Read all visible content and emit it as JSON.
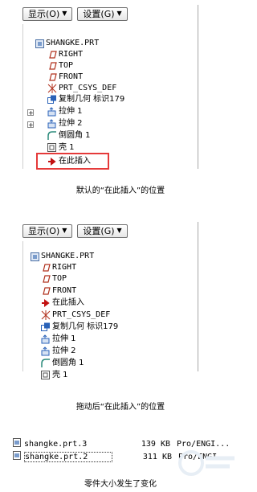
{
  "panel1": {
    "toolbar": {
      "show_label": "显示(O)",
      "settings_label": "设置(G)"
    },
    "items": [
      {
        "label": "SHANGKE.PRT",
        "icon": "part-icon"
      },
      {
        "label": "RIGHT",
        "icon": "datum-plane-icon"
      },
      {
        "label": "TOP",
        "icon": "datum-plane-icon"
      },
      {
        "label": "FRONT",
        "icon": "datum-plane-icon"
      },
      {
        "label": "PRT_CSYS_DEF",
        "icon": "csys-icon"
      },
      {
        "label": "复制几何 标识179",
        "icon": "copy-geometry-icon"
      },
      {
        "label": "拉伸 1",
        "icon": "extrude-icon"
      },
      {
        "label": "拉伸 2",
        "icon": "extrude-icon"
      },
      {
        "label": "倒圆角 1",
        "icon": "round-icon"
      },
      {
        "label": "壳 1",
        "icon": "shell-icon"
      },
      {
        "label": "在此插入",
        "icon": "insert-arrow-icon"
      }
    ],
    "caption": "默认的“在此插入”的位置"
  },
  "panel2": {
    "toolbar": {
      "show_label": "显示(O)",
      "settings_label": "设置(G)"
    },
    "items": [
      {
        "label": "SHANGKE.PRT",
        "icon": "part-icon"
      },
      {
        "label": "RIGHT",
        "icon": "datum-plane-icon"
      },
      {
        "label": "TOP",
        "icon": "datum-plane-icon"
      },
      {
        "label": "FRONT",
        "icon": "datum-plane-icon"
      },
      {
        "label": "在此插入",
        "icon": "insert-arrow-icon"
      },
      {
        "label": "PRT_CSYS_DEF",
        "icon": "csys-icon"
      },
      {
        "label": "复制几何 标识179",
        "icon": "copy-geometry-icon"
      },
      {
        "label": "拉伸 1",
        "icon": "extrude-icon"
      },
      {
        "label": "拉伸 2",
        "icon": "extrude-icon"
      },
      {
        "label": "倒圆角 1",
        "icon": "round-icon"
      },
      {
        "label": "壳 1",
        "icon": "shell-icon"
      }
    ],
    "caption": "拖动后“在此插入”的位置"
  },
  "files": [
    {
      "name": "shangke.prt.3",
      "size": "139 KB",
      "type": "Pro/ENGI..."
    },
    {
      "name": "shangke.prt.2",
      "size": "311 KB",
      "type": "Pro/ENGI..."
    }
  ],
  "files_caption": "零件大小发生了变化",
  "colors": {
    "highlight_red": "#e53a3a",
    "insert_arrow": "#c21010",
    "datum": "#b0301c",
    "feature_blue": "#2a62b8"
  }
}
